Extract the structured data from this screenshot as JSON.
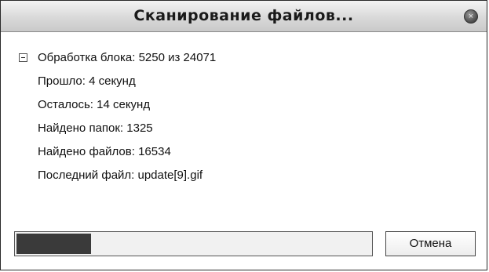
{
  "window": {
    "title": "Сканирование файлов...",
    "close_icon": "close-icon",
    "close_symbol": "×"
  },
  "status": {
    "block_progress": "Обработка блока: 5250 из 24071",
    "elapsed": "Прошло: 4 секунд",
    "remaining": "Осталось: 14 секунд",
    "folders_found": "Найдено папок: 1325",
    "files_found": "Найдено файлов: 16534",
    "last_file": "Последний файл: update[9].gif"
  },
  "progress": {
    "fraction": 0.21
  },
  "buttons": {
    "cancel_label": "Отмена"
  }
}
